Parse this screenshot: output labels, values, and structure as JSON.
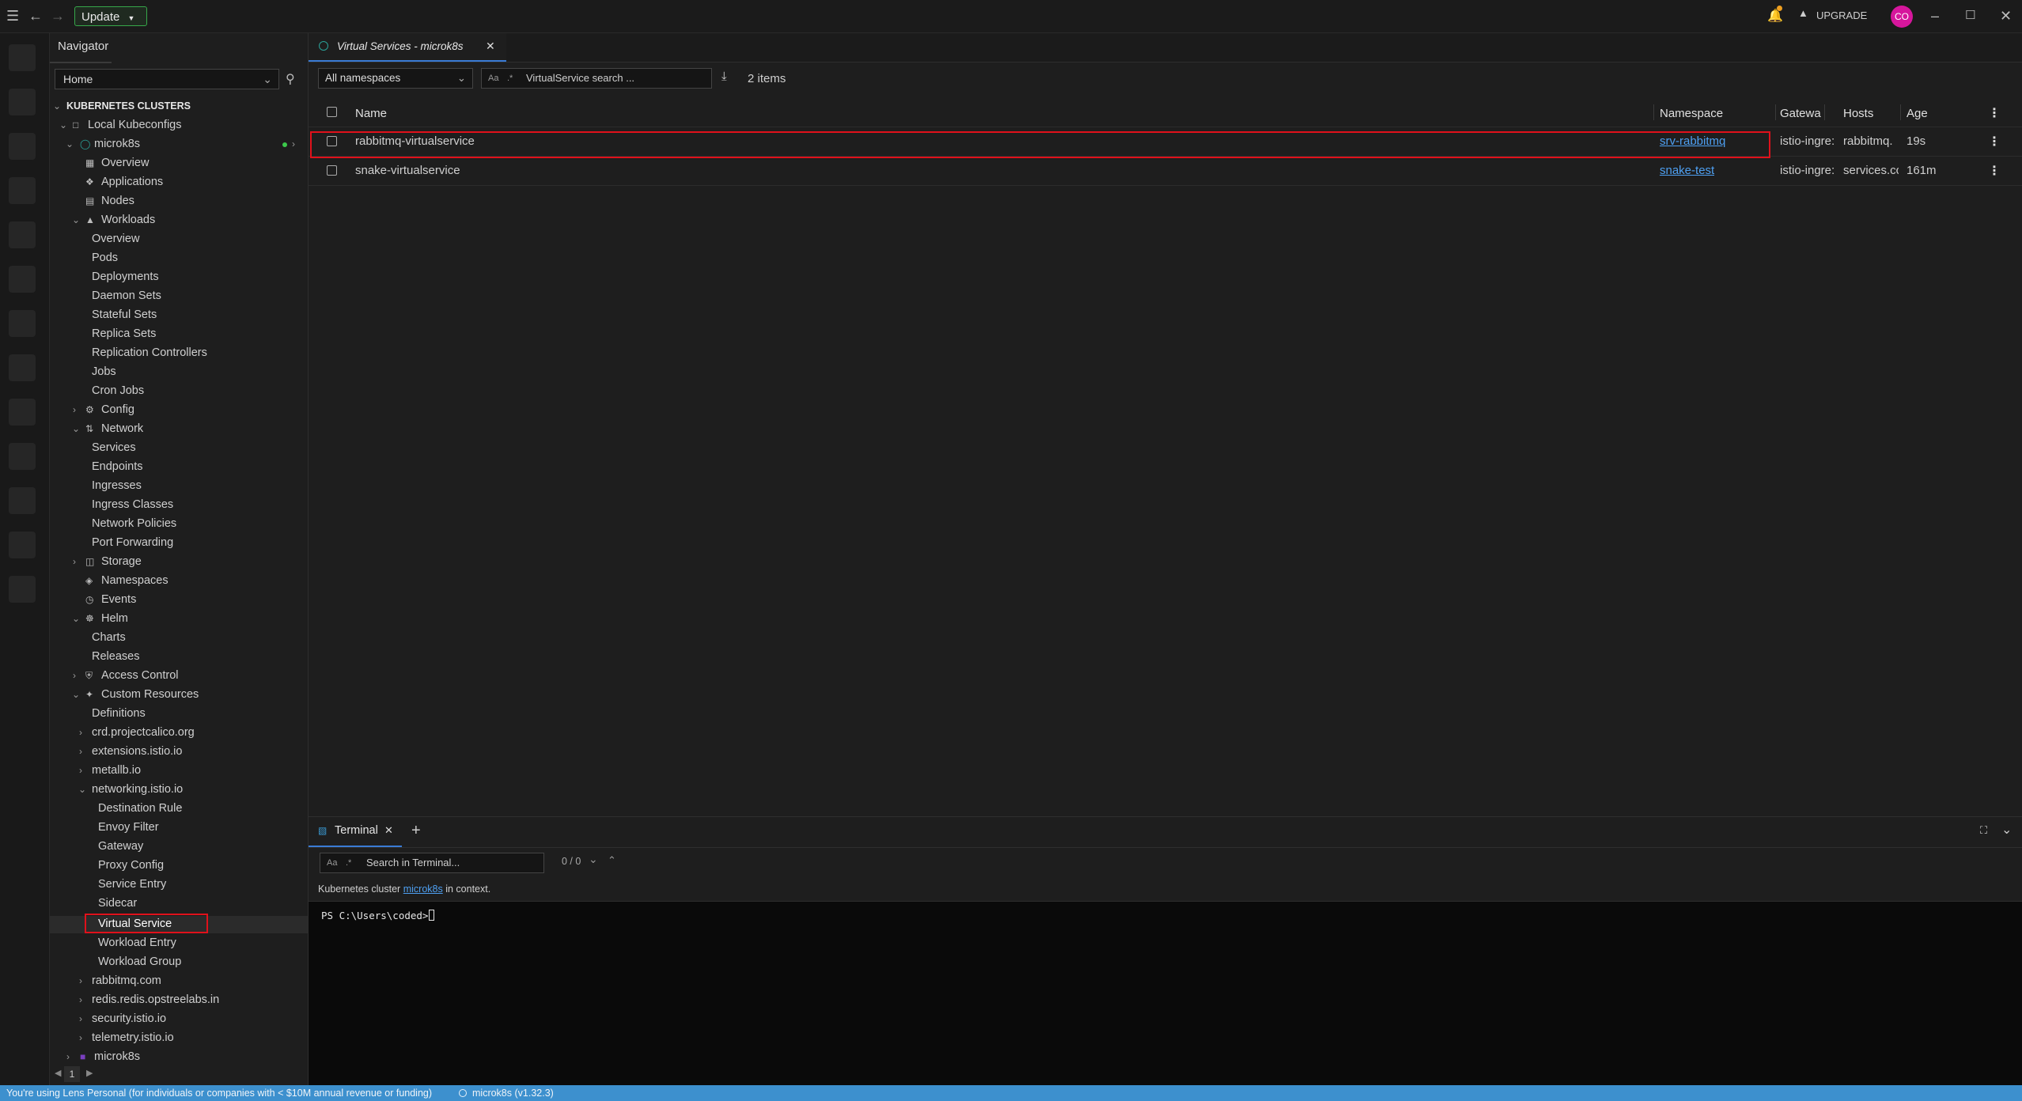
{
  "topbar": {
    "update_label": "Update",
    "upgrade_label": "UPGRADE",
    "avatar_initials": "CO",
    "notification_dot_color": "#f0a020"
  },
  "navigator": {
    "title": "Navigator",
    "location_select": "Home",
    "section_title": "KUBERNETES CLUSTERS",
    "group_label": "Local Kubeconfigs",
    "cluster": "microk8s",
    "top_items": [
      "Overview",
      "Applications",
      "Nodes"
    ],
    "workloads": {
      "label": "Workloads",
      "items": [
        "Overview",
        "Pods",
        "Deployments",
        "Daemon Sets",
        "Stateful Sets",
        "Replica Sets",
        "Replication Controllers",
        "Jobs",
        "Cron Jobs"
      ]
    },
    "config": "Config",
    "network": {
      "label": "Network",
      "items": [
        "Services",
        "Endpoints",
        "Ingresses",
        "Ingress Classes",
        "Network Policies",
        "Port Forwarding"
      ]
    },
    "storage": "Storage",
    "namespaces": "Namespaces",
    "events": "Events",
    "helm": {
      "label": "Helm",
      "items": [
        "Charts",
        "Releases"
      ]
    },
    "access_control": "Access Control",
    "custom_resources": {
      "label": "Custom Resources",
      "definitions": "Definitions",
      "groups_before": [
        "crd.projectcalico.org",
        "extensions.istio.io",
        "metallb.io"
      ],
      "networking": {
        "label": "networking.istio.io",
        "items": [
          "Destination Rule",
          "Envoy Filter",
          "Gateway",
          "Proxy Config",
          "Service Entry",
          "Sidecar",
          "Virtual Service",
          "Workload Entry",
          "Workload Group"
        ]
      },
      "groups_after": [
        "rabbitmq.com",
        "redis.redis.opstreelabs.in",
        "security.istio.io",
        "telemetry.istio.io"
      ]
    },
    "second_cluster": "microk8s",
    "page_number": "1"
  },
  "tab": {
    "title": "Virtual Services - microk8s"
  },
  "toolbar": {
    "namespace_select": "All namespaces",
    "search_prefix": "Aa",
    "search_placeholder": "VirtualService search ...",
    "item_count": "2 items"
  },
  "table": {
    "columns": [
      "Name",
      "Namespace",
      "Gatewa",
      "Hosts",
      "Age"
    ],
    "rows": [
      {
        "name": "rabbitmq-virtualservice",
        "namespace": "srv-rabbitmq",
        "gateway": "istio-ingre:",
        "hosts": "rabbitmq.",
        "age": "19s"
      },
      {
        "name": "snake-virtualservice",
        "namespace": "snake-test",
        "gateway": "istio-ingre:",
        "hosts": "services.cc",
        "age": "161m"
      }
    ]
  },
  "terminal": {
    "tab_label": "Terminal",
    "search_prefix": "Aa",
    "search_placeholder": "Search in Terminal...",
    "match_count": "0 / 0",
    "info_before": "Kubernetes cluster",
    "info_link": "microk8s",
    "info_after": "in context.",
    "prompt": "PS C:\\Users\\coded>"
  },
  "statusbar": {
    "license_text": "You're using Lens Personal (for individuals or companies with < $10M annual revenue or funding)",
    "cluster_text": "microk8s (v1.32.3)"
  }
}
